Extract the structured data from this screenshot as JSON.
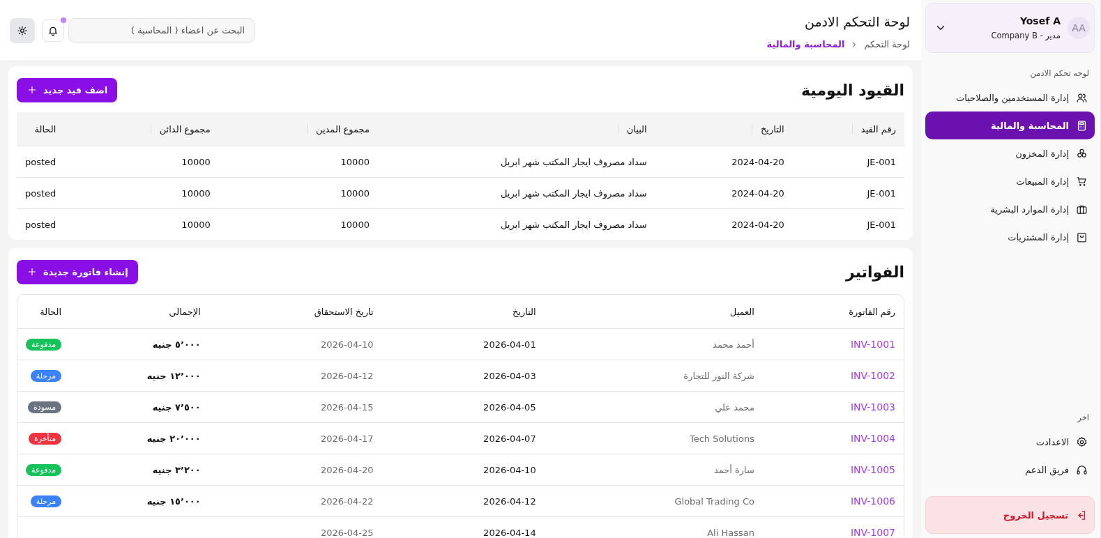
{
  "sidebar": {
    "profile": {
      "initials": "AA",
      "name": "Yosef A",
      "role": "مدير - Company B"
    },
    "section_label": "لوحه تحكم الادمن",
    "items": [
      {
        "label": "إدارة المستخدمين والصلاحيات",
        "selected": false
      },
      {
        "label": "المحاسبة والمالية",
        "selected": true
      },
      {
        "label": "إدارة المخزون",
        "selected": false
      },
      {
        "label": "إدارة المبيعات",
        "selected": false
      },
      {
        "label": "إدارة الموارد البشرية",
        "selected": false
      },
      {
        "label": "إدارة المشتريات",
        "selected": false
      }
    ],
    "other_label": "اخر",
    "other_items": [
      {
        "label": "الاعدادت"
      },
      {
        "label": "فريق الدعم"
      }
    ],
    "logout": "تسجيل الخروج"
  },
  "header": {
    "title": "لوحة التحكم الادمن",
    "breadcrumb": [
      "لوحة التحكم",
      "المحاسبة والمالية"
    ],
    "search": {
      "placeholder": "البحث عن اعضاء ( المحاسبة )"
    },
    "notification_dot": true
  },
  "journal": {
    "title": "القيود اليومية",
    "button": "اضف قيد جديد",
    "columns": [
      "رقم القيد",
      "التاريخ",
      "البيان",
      "مجموع المدين",
      "مجموع الدائن",
      "الحالة"
    ],
    "rows": [
      [
        "JE-001",
        "2024-04-20",
        "سداد مصروف ايجار المكتب شهر ابريل",
        "10000",
        "10000",
        "posted"
      ],
      [
        "JE-001",
        "2024-04-20",
        "سداد مصروف ايجار المكتب شهر ابريل",
        "10000",
        "10000",
        "posted"
      ],
      [
        "JE-001",
        "2024-04-20",
        "سداد مصروف ايجار المكتب شهر ابريل",
        "10000",
        "10000",
        "posted"
      ]
    ]
  },
  "invoices": {
    "title": "الفواتير",
    "button": "إنشاء فاتورة جديدة",
    "columns": [
      "رقم الفاتورة",
      "العميل",
      "التاريخ",
      "تاريخ الاستحقاق",
      "الإجمالي",
      "الحالة"
    ],
    "rows": [
      {
        "id": "INV-1001",
        "client": "أحمد محمد",
        "date": "2026-04-01",
        "due": "2026-04-10",
        "total": "٥٬٠٠٠ جنيه",
        "status": "مدفوعة",
        "color": "#16c25a"
      },
      {
        "id": "INV-1002",
        "client": "شركة النور للتجارة",
        "date": "2026-04-03",
        "due": "2026-04-12",
        "total": "١٢٬٠٠٠ جنيه",
        "status": "مرحلة",
        "color": "#3b82f6"
      },
      {
        "id": "INV-1003",
        "client": "محمد علي",
        "date": "2026-04-05",
        "due": "2026-04-15",
        "total": "٧٬٥٠٠ جنيه",
        "status": "مسودة",
        "color": "#6b7280"
      },
      {
        "id": "INV-1004",
        "client": "Tech Solutions",
        "date": "2026-04-07",
        "due": "2026-04-17",
        "total": "٢٠٬٠٠٠ جنيه",
        "status": "متأخرة",
        "color": "#ef3340"
      },
      {
        "id": "INV-1005",
        "client": "سارة أحمد",
        "date": "2026-04-10",
        "due": "2026-04-20",
        "total": "٣٬٢٠٠ جنيه",
        "status": "مدفوعة",
        "color": "#16c25a"
      },
      {
        "id": "INV-1006",
        "client": "Global Trading Co",
        "date": "2026-04-12",
        "due": "2026-04-22",
        "total": "١٥٬٠٠٠ جنيه",
        "status": "مرحلة",
        "color": "#3b82f6"
      },
      {
        "id": "INV-1007",
        "client": "Ali Hassan",
        "date": "2026-04-14",
        "due": "2026-04-25"
      }
    ]
  }
}
